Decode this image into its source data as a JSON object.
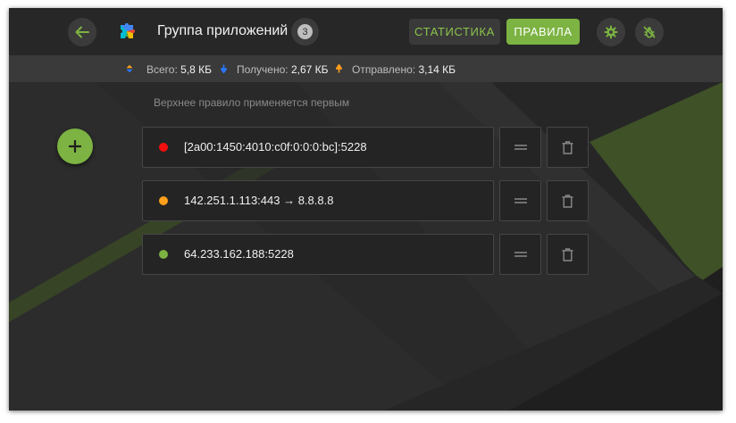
{
  "header": {
    "title": "Группа приложений",
    "count": "3",
    "tabs": [
      {
        "label": "СТАТИСТИКА",
        "active": false
      },
      {
        "label": "ПРАВИЛА",
        "active": true
      }
    ],
    "icons": [
      "back-arrow-icon",
      "app-group-icon",
      "gear-icon",
      "bug-off-icon"
    ]
  },
  "stats": {
    "total_label": "Всего:",
    "total_value": "5,8 КБ",
    "received_label": "Получено:",
    "received_value": "2,67 КБ",
    "sent_label": "Отправлено:",
    "sent_value": "3,14 КБ"
  },
  "rules_hint": "Верхнее правило применяется первым",
  "rules": [
    {
      "text": "[2a00:1450:4010:c0f:0:0:0:bc]:5228",
      "status_color": "#f50e0e"
    },
    {
      "text": "142.251.1.113:443 → 8.8.8.8",
      "status_color": "#ff9f1a"
    },
    {
      "text": "64.233.162.188:5228",
      "status_color": "#7cb342"
    }
  ],
  "colors": {
    "accent": "#7cb342",
    "background": "#2b2b2b"
  }
}
